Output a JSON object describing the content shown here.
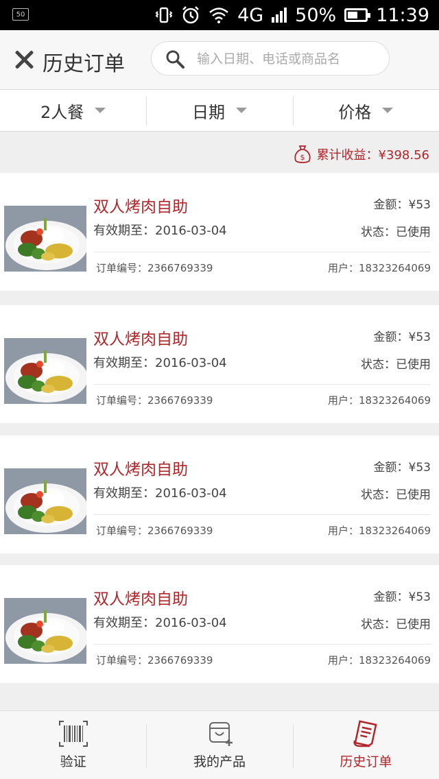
{
  "status_bar": {
    "left_badge": "50",
    "network": "4G",
    "battery_percent": "50%",
    "time": "11:39"
  },
  "header": {
    "title": "历史订单",
    "search_placeholder": "输入日期、电话或商品名"
  },
  "filters": [
    {
      "label": "2人餐"
    },
    {
      "label": "日期"
    },
    {
      "label": "价格"
    }
  ],
  "earnings": {
    "label": "累计收益：¥398.56"
  },
  "orders": [
    {
      "name": "双人烤肉自助",
      "valid": "有效期至：2016-03-04",
      "amount": "金额：¥53",
      "status": "状态：已使用",
      "order_no": "订单编号：2366769339",
      "user": "用户：18323264069"
    },
    {
      "name": "双人烤肉自助",
      "valid": "有效期至：2016-03-04",
      "amount": "金额：¥53",
      "status": "状态：已使用",
      "order_no": "订单编号：2366769339",
      "user": "用户：18323264069"
    },
    {
      "name": "双人烤肉自助",
      "valid": "有效期至：2016-03-04",
      "amount": "金额：¥53",
      "status": "状态：已使用",
      "order_no": "订单编号：2366769339",
      "user": "用户：18323264069"
    },
    {
      "name": "双人烤肉自助",
      "valid": "有效期至：2016-03-04",
      "amount": "金额：¥53",
      "status": "状态：已使用",
      "order_no": "订单编号：2366769339",
      "user": "用户：18323264069"
    }
  ],
  "tabs": [
    {
      "label": "验证",
      "icon": "barcode-scan-icon"
    },
    {
      "label": "我的产品",
      "icon": "product-add-icon"
    },
    {
      "label": "历史订单",
      "icon": "receipt-icon",
      "active": true
    }
  ],
  "colors": {
    "accent": "#b0262a",
    "background": "#efefef"
  }
}
